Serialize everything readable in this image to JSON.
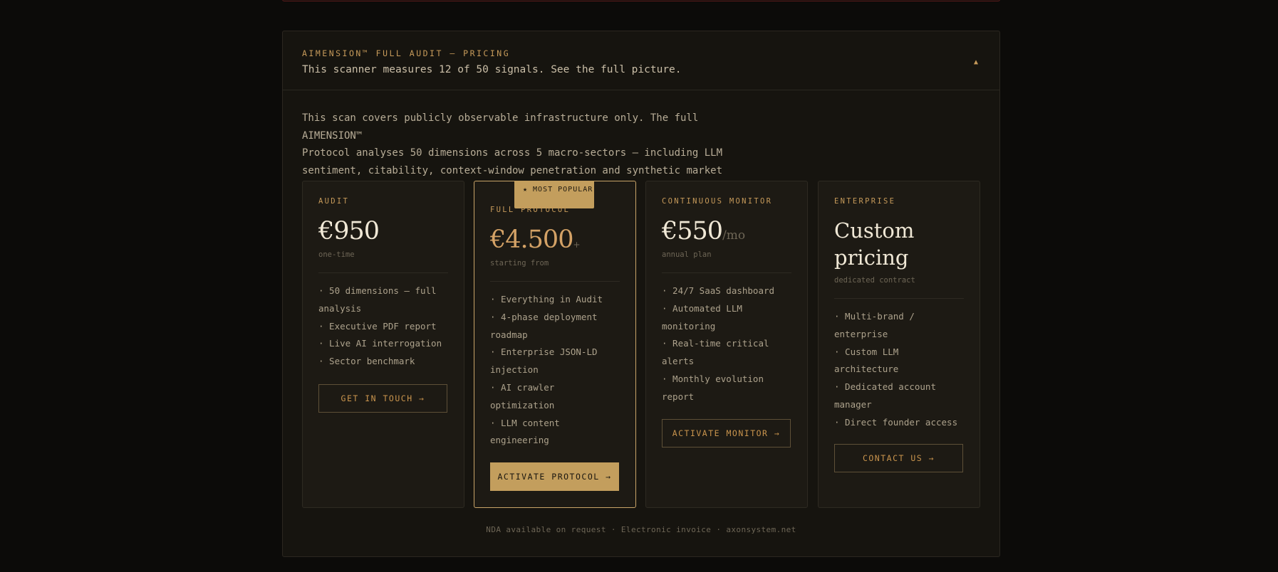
{
  "header": {
    "kicker": "AIMENSION™ FULL AUDIT — PRICING",
    "subtitle": "This scanner measures 12 of 50 signals. See the full picture.",
    "caret": "▲"
  },
  "intro": {
    "line1": "This scan covers publicly observable infrastructure only. The full AIMENSION™",
    "line2": "Protocol analyses 50 dimensions across 5 macro-sectors — including LLM",
    "line3": "sentiment, citability, context-window penetration and synthetic market share."
  },
  "plans": {
    "audit": {
      "tier": "AUDIT",
      "price": "€950",
      "note": "one-time",
      "features": [
        "· 50 dimensions — full analysis",
        "· Executive PDF report",
        "· Live AI interrogation",
        "· Sector benchmark"
      ],
      "cta": "GET IN TOUCH →"
    },
    "protocol": {
      "badge": "★ MOST POPULAR",
      "tier": "FULL PROTOCOL",
      "price": "€4.500",
      "price_plus": "+",
      "note": "starting from",
      "features": [
        "· Everything in Audit",
        "· 4-phase deployment roadmap",
        "· Enterprise JSON-LD injection",
        "· AI crawler optimization",
        "· LLM content engineering"
      ],
      "cta": "ACTIVATE PROTOCOL →"
    },
    "monitor": {
      "tier": "CONTINUOUS MONITOR",
      "price": "€550",
      "price_suffix": "/mo",
      "note": "annual plan",
      "features": [
        "· 24/7 SaaS dashboard",
        "· Automated LLM monitoring",
        "· Real-time critical alerts",
        "· Monthly evolution report"
      ],
      "cta": "ACTIVATE MONITOR →"
    },
    "enterprise": {
      "tier": "ENTERPRISE",
      "price": "Custom pricing",
      "note": "dedicated contract",
      "features": [
        "· Multi-brand / enterprise",
        "· Custom LLM architecture",
        "· Dedicated account manager",
        "· Direct founder access"
      ],
      "cta": "CONTACT US →"
    }
  },
  "footer": {
    "note": "NDA available on request · Electronic invoice · axonsystem.net"
  },
  "colors": {
    "accent": "#c69a5a",
    "button_solid": "#c39e5d",
    "background": "#0c0b09",
    "panel": "#16140f"
  }
}
